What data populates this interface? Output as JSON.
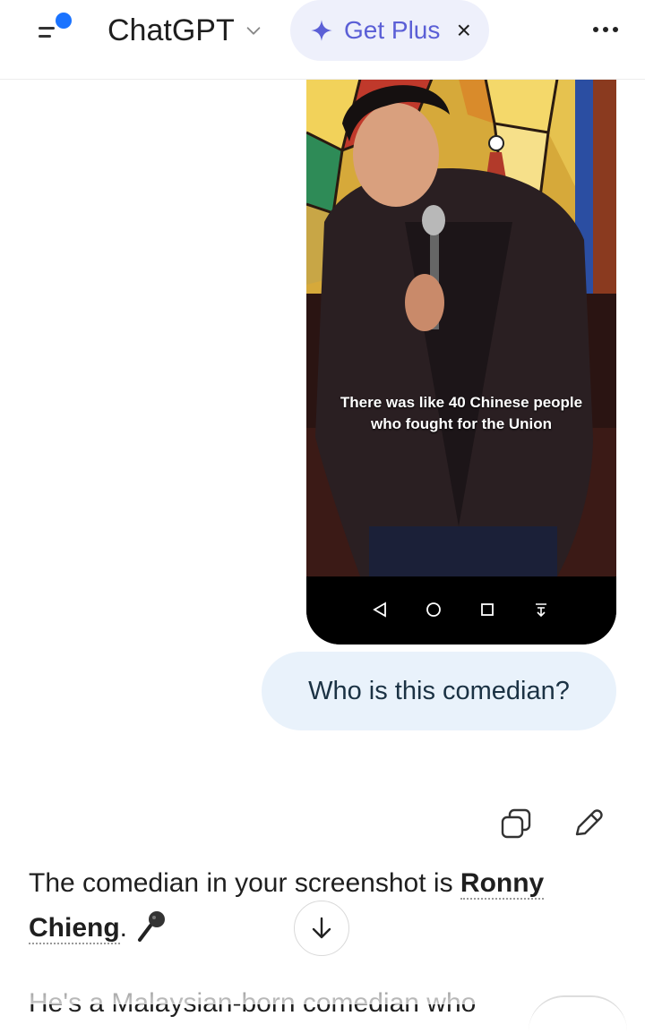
{
  "header": {
    "title": "ChatGPT",
    "plus_label": "Get Plus",
    "close_glyph": "×",
    "icons": {
      "menu": "menu-with-notification-dot-icon",
      "chevron": "chevron-down-icon",
      "spark": "sparkle-icon",
      "more": "more-horizontal-icon"
    },
    "notification_color": "#1a73ff",
    "plus_color": "#5b5fd6"
  },
  "screenshot": {
    "caption_line1": "There was like 40 Chinese people",
    "caption_line2": "who fought for the Union",
    "nav_icons": [
      "back-triangle-icon",
      "home-circle-icon",
      "recents-square-icon",
      "notification-pull-icon"
    ]
  },
  "conversation": {
    "user_message": "Who is this comedian?",
    "actions": [
      "copy-icon",
      "edit-pencil-icon"
    ],
    "answer_prefix": "The comedian in your screenshot is ",
    "answer_name": "Ronny Chieng",
    "answer_suffix": ".",
    "answer_emoji_icon": "microphone-icon",
    "answer_next_line_partial": "He's a Malaysian-born comedian who"
  },
  "colors": {
    "user_bubble_bg": "#e9f2fb",
    "user_text": "#1b3244"
  }
}
